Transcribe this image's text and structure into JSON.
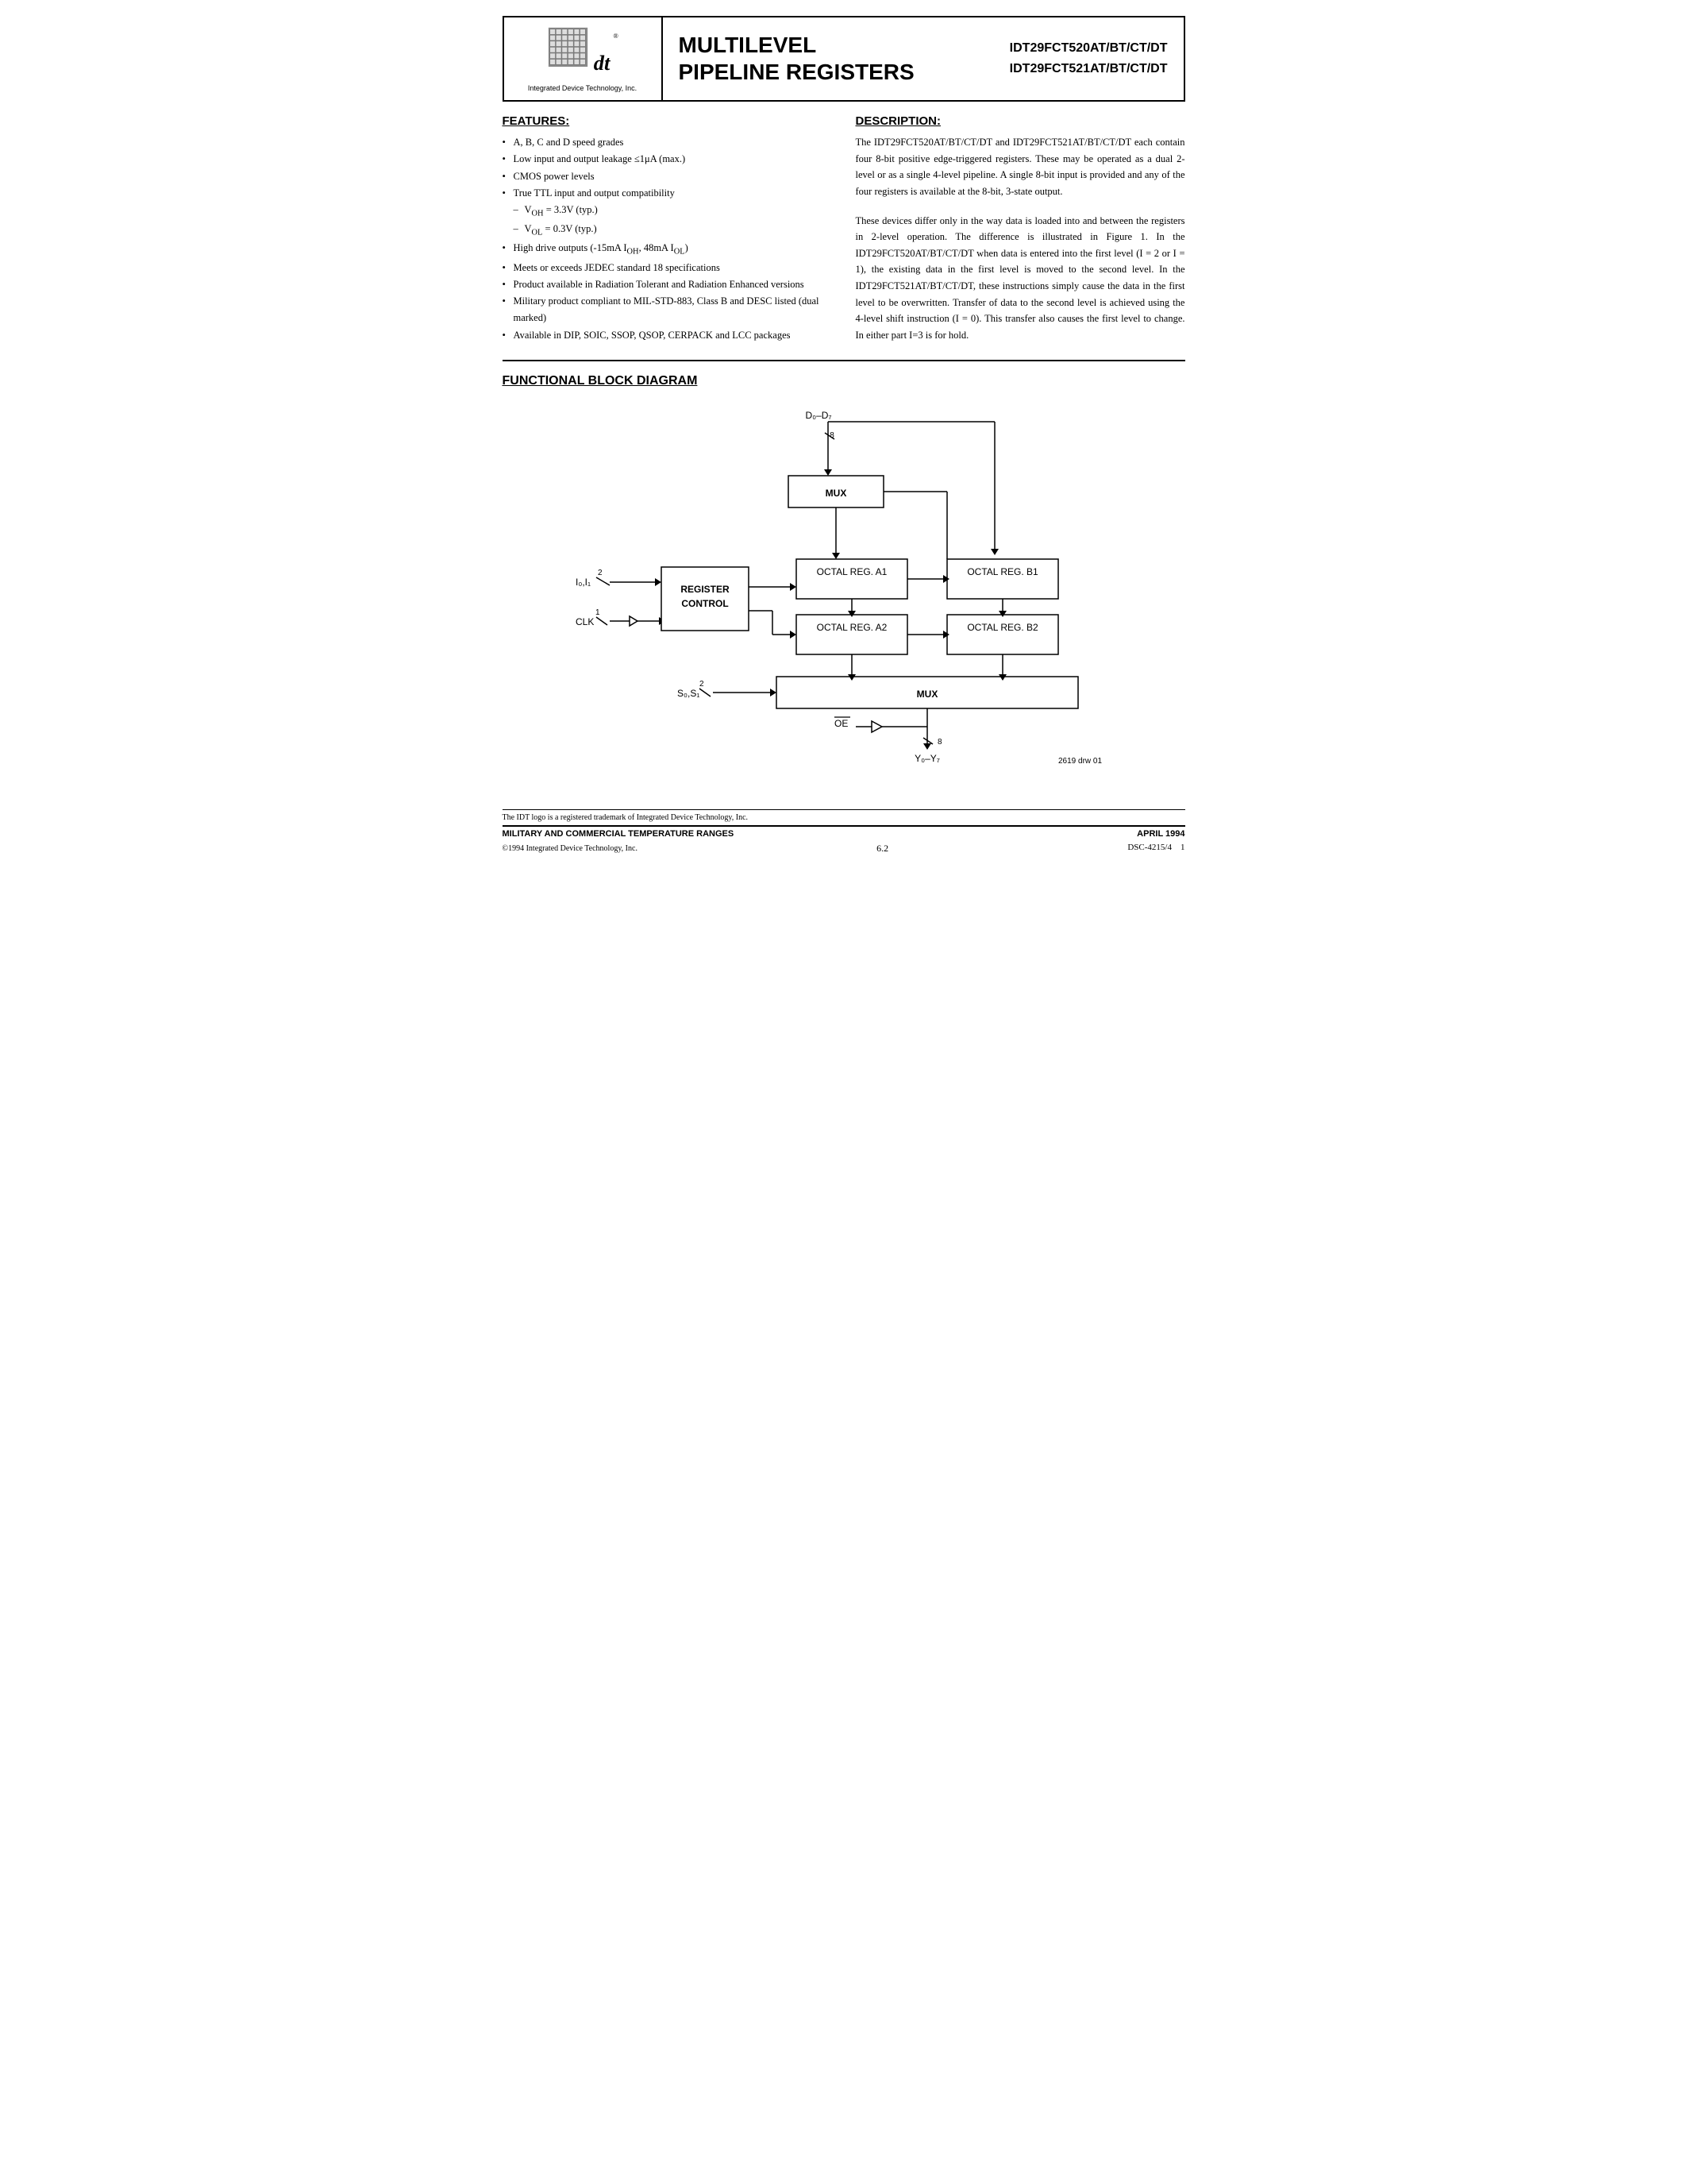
{
  "header": {
    "logo_text": "Integrated Device Technology, Inc.",
    "title_line1": "MULTILEVEL",
    "title_line2": "PIPELINE REGISTERS",
    "part_line1": "IDT29FCT520AT/BT/CT/DT",
    "part_line2": "IDT29FCT521AT/BT/CT/DT"
  },
  "features": {
    "heading": "FEATURES:",
    "items": [
      "A, B, C and D speed grades",
      "Low input and output leakage ≤1μA (max.)",
      "CMOS power levels",
      "True TTL input and output compatibility",
      "VOH = 3.3V (typ.)",
      "VOL = 0.3V (typ.)",
      "High drive outputs (-15mA IOH, 48mA IOL)",
      "Meets or exceeds JEDEC standard 18 specifications",
      "Product available in Radiation Tolerant and Radiation Enhanced versions",
      "Military product compliant to MIL-STD-883, Class B and DESC listed (dual marked)",
      "Available in DIP, SOIC, SSOP, QSOP, CERPACK and LCC packages"
    ]
  },
  "description": {
    "heading": "DESCRIPTION:",
    "text1": "The IDT29FCT520AT/BT/CT/DT and IDT29FCT521AT/BT/CT/DT each contain four 8-bit positive edge-triggered registers. These may be operated as a dual 2-level or as a single 4-level pipeline. A single 8-bit input is provided and any of the four registers is available at the 8-bit, 3-state output.",
    "text2": "These devices differ only in the way data is loaded into and between the registers in 2-level operation. The difference is illustrated in Figure 1. In the IDT29FCT520AT/BT/CT/DT when data is entered into the first level (I = 2 or I = 1), the existing data in the first level is moved to the second level. In the IDT29FCT521AT/BT/CT/DT, these instructions simply cause the data in the first level to be overwritten. Transfer of data to the second level is achieved using the 4-level shift instruction (I = 0). This transfer also causes the first level to change. In either part I=3 is for hold."
  },
  "diagram": {
    "heading": "FUNCTIONAL BLOCK DIAGRAM",
    "labels": {
      "d_input": "D0–D7",
      "mux_top": "MUX",
      "octal_a1": "OCTAL REG. A1",
      "octal_a2": "OCTAL REG. A2",
      "octal_b1": "OCTAL REG. B1",
      "octal_b2": "OCTAL REG. B2",
      "register_control": "REGISTER\nCONTROL",
      "io_input": "I0,I1",
      "clk_input": "CLK",
      "s_input": "S0,S1",
      "mux_bottom": "MUX",
      "oe_input": "OE",
      "y_output": "Y0–Y7",
      "draw_num": "2619 drw 01",
      "bit_8_top": "8",
      "bit_8_bottom": "8"
    }
  },
  "footer": {
    "trademark_text": "The IDT logo is a registered trademark of Integrated Device Technology, Inc.",
    "bottom_left": "MILITARY AND COMMERCIAL TEMPERATURE RANGES",
    "bottom_right": "APRIL 1994",
    "copyright": "©1994 Integrated Device Technology, Inc.",
    "page_num": "6.2",
    "dsc": "DSC-4215/4",
    "page": "1"
  }
}
